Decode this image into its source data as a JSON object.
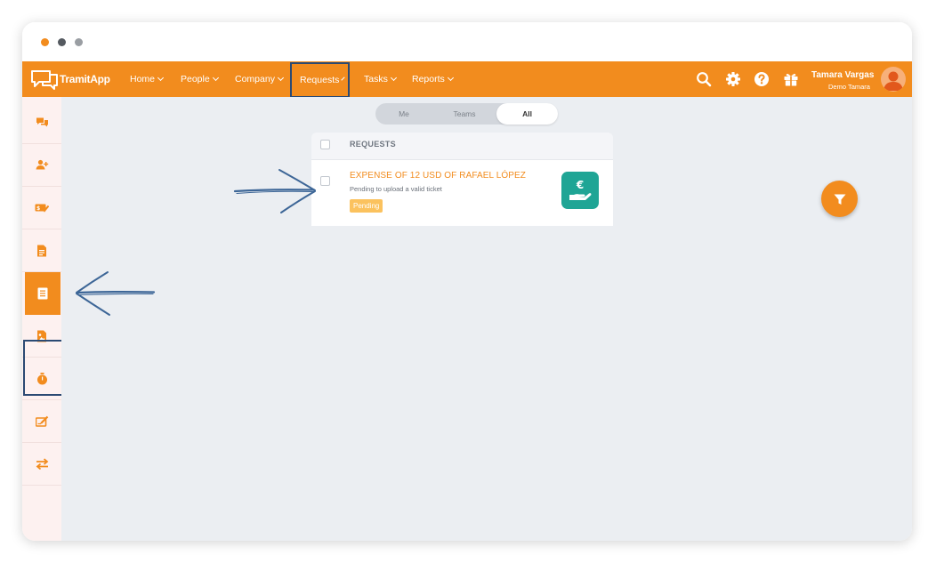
{
  "app": {
    "logo_text": "TramitApp"
  },
  "nav": {
    "items": [
      {
        "label": "Home"
      },
      {
        "label": "People"
      },
      {
        "label": "Company"
      },
      {
        "label": "Requests"
      },
      {
        "label": "Tasks"
      },
      {
        "label": "Reports"
      }
    ],
    "selected": "Requests"
  },
  "header_icons": [
    "search-icon",
    "gear-icon",
    "help-icon",
    "gift-icon"
  ],
  "user": {
    "name": "Tamara Vargas",
    "company": "Demo Tamara"
  },
  "sidebar": {
    "items": [
      {
        "icon": "chat-icon"
      },
      {
        "icon": "add-user-icon"
      },
      {
        "icon": "expense-icon"
      },
      {
        "icon": "document-icon"
      },
      {
        "icon": "requests-icon",
        "active": true
      },
      {
        "icon": "image-document-icon"
      },
      {
        "icon": "stopwatch-icon"
      },
      {
        "icon": "signature-icon"
      },
      {
        "icon": "transfer-icon"
      }
    ]
  },
  "scope_toggle": {
    "options": [
      "Me",
      "Teams",
      "All"
    ],
    "selected": "All"
  },
  "requests": {
    "header": "REQUESTS",
    "rows": [
      {
        "title": "EXPENSE OF 12 USD OF RAFAEL LÓPEZ",
        "subtitle": "Pending to upload a valid ticket",
        "status": "Pending",
        "icon_symbol": "€"
      }
    ]
  },
  "colors": {
    "brand": "#f28c1e",
    "highlight": "#2b4a73",
    "badge": "#fbc25e",
    "expense_icon": "#1fa595"
  }
}
